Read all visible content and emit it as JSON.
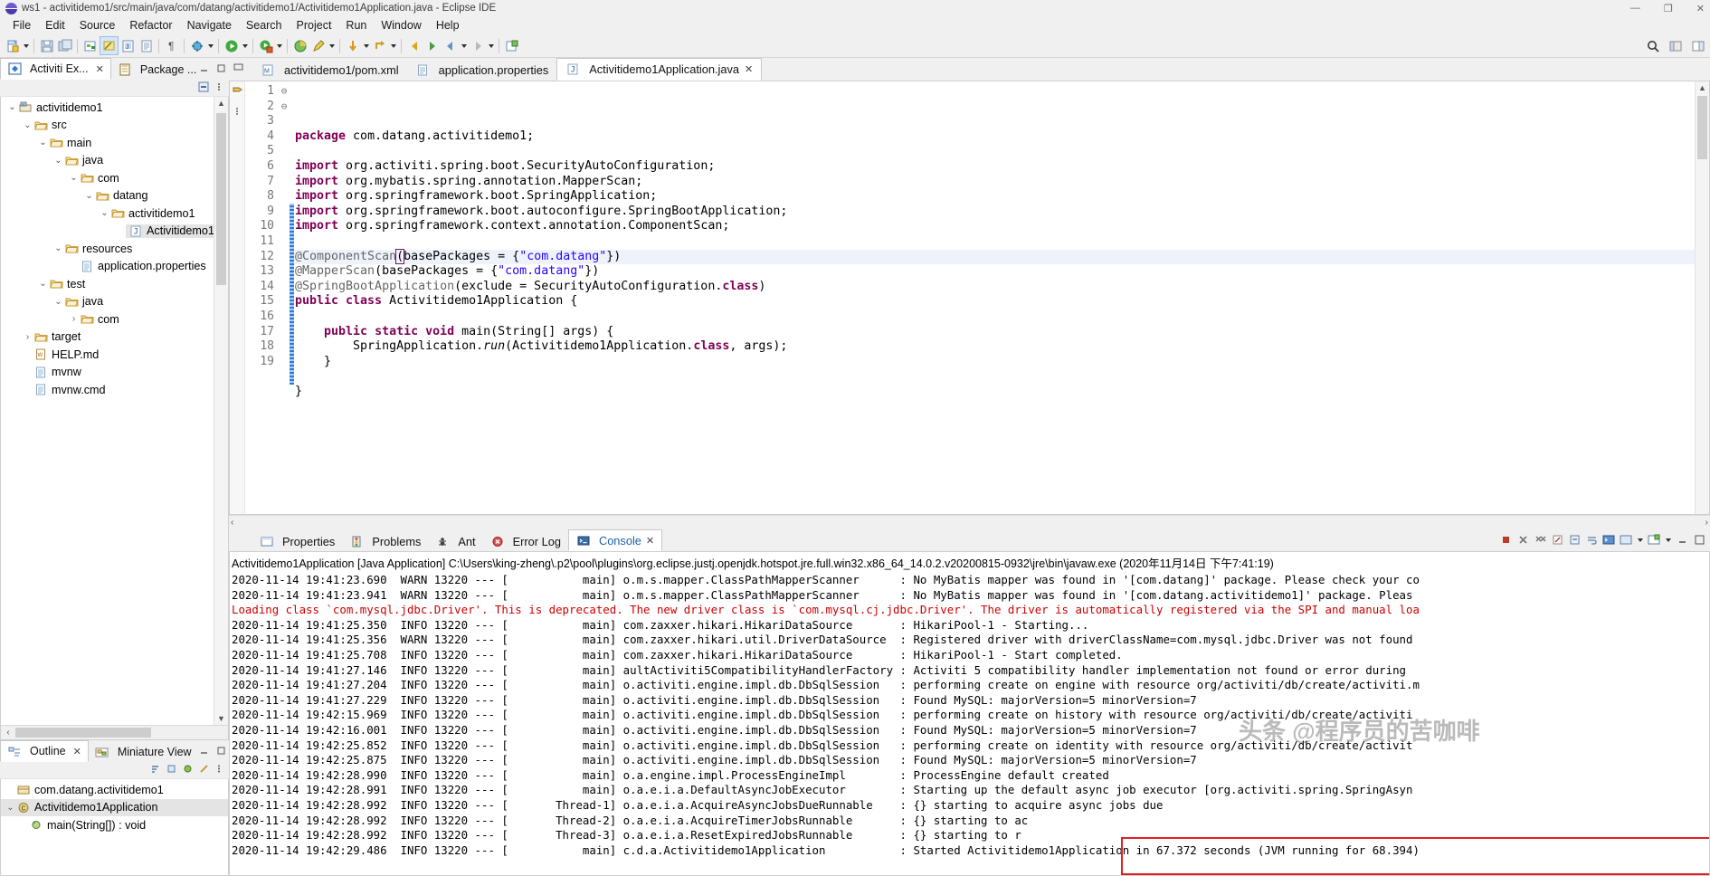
{
  "window": {
    "title": "ws1 - activitidemo1/src/main/java/com/datang/activitidemo1/Activitidemo1Application.java - Eclipse IDE",
    "minimize": "—",
    "maximize": "❐",
    "close": "✕"
  },
  "menu": [
    "File",
    "Edit",
    "Source",
    "Refactor",
    "Navigate",
    "Search",
    "Project",
    "Run",
    "Window",
    "Help"
  ],
  "left_panel": {
    "tabs": [
      {
        "label": "Activiti Ex...",
        "icon": "activiti-diamond-icon",
        "active": true,
        "close": "✕"
      },
      {
        "label": "Package ...",
        "icon": "package-explorer-icon",
        "active": false,
        "close": ""
      }
    ],
    "tree": [
      {
        "indent": 0,
        "twisty": "v",
        "icon": "project-icon",
        "label": "activitidemo1",
        "selected": false
      },
      {
        "indent": 1,
        "twisty": "v",
        "icon": "folder-icon",
        "label": "src",
        "selected": false
      },
      {
        "indent": 2,
        "twisty": "v",
        "icon": "folder-icon",
        "label": "main",
        "selected": false
      },
      {
        "indent": 3,
        "twisty": "v",
        "icon": "folder-icon",
        "label": "java",
        "selected": false
      },
      {
        "indent": 4,
        "twisty": "v",
        "icon": "folder-icon",
        "label": "com",
        "selected": false
      },
      {
        "indent": 5,
        "twisty": "v",
        "icon": "folder-icon",
        "label": "datang",
        "selected": false
      },
      {
        "indent": 6,
        "twisty": "v",
        "icon": "folder-icon",
        "label": "activitidemo1",
        "selected": false
      },
      {
        "indent": 7,
        "twisty": "",
        "icon": "java-file-icon",
        "label": "Activitidemo1",
        "selected": true
      },
      {
        "indent": 3,
        "twisty": "v",
        "icon": "folder-icon",
        "label": "resources",
        "selected": false
      },
      {
        "indent": 4,
        "twisty": "",
        "icon": "properties-file-icon",
        "label": "application.properties",
        "selected": false
      },
      {
        "indent": 2,
        "twisty": "v",
        "icon": "folder-icon",
        "label": "test",
        "selected": false
      },
      {
        "indent": 3,
        "twisty": "v",
        "icon": "folder-icon",
        "label": "java",
        "selected": false
      },
      {
        "indent": 4,
        "twisty": ">",
        "icon": "folder-icon",
        "label": "com",
        "selected": false
      },
      {
        "indent": 1,
        "twisty": ">",
        "icon": "folder-icon",
        "label": "target",
        "selected": false
      },
      {
        "indent": 1,
        "twisty": "",
        "icon": "md-file-icon",
        "label": "HELP.md",
        "selected": false
      },
      {
        "indent": 1,
        "twisty": "",
        "icon": "text-file-icon",
        "label": "mvnw",
        "selected": false
      },
      {
        "indent": 1,
        "twisty": "",
        "icon": "text-file-icon",
        "label": "mvnw.cmd",
        "selected": false
      }
    ]
  },
  "outline_panel": {
    "tabs": [
      {
        "label": "Outline",
        "icon": "outline-icon",
        "active": true,
        "close": "✕"
      },
      {
        "label": "Miniature View",
        "icon": "miniature-view-icon",
        "active": false,
        "close": ""
      }
    ],
    "items": [
      {
        "indent": 0,
        "twisty": "",
        "icon": "package-icon",
        "label": "com.datang.activitidemo1",
        "selected": false
      },
      {
        "indent": 0,
        "twisty": "v",
        "icon": "class-icon",
        "label": "Activitidemo1Application",
        "selected": true
      },
      {
        "indent": 1,
        "twisty": "",
        "icon": "method-icon",
        "label": "main(String[]) : void",
        "selected": false
      }
    ]
  },
  "editor": {
    "tabs": [
      {
        "label": "activitidemo1/pom.xml",
        "icon": "maven-file-icon",
        "active": false,
        "close": ""
      },
      {
        "label": "application.properties",
        "icon": "properties-file-icon",
        "active": false,
        "close": ""
      },
      {
        "label": "Activitidemo1Application.java",
        "icon": "java-file-icon",
        "active": true,
        "close": "✕"
      }
    ],
    "lines": [
      {
        "n": 1,
        "fold": "",
        "hl": false,
        "html": "<span class='kw'>package</span> com.datang.activitidemo1;"
      },
      {
        "n": 2,
        "fold": "",
        "hl": false,
        "html": ""
      },
      {
        "n": 3,
        "fold": "⊖",
        "hl": false,
        "html": "<span class='kw'>import</span> org.activiti.spring.boot.SecurityAutoConfiguration;"
      },
      {
        "n": 4,
        "fold": "",
        "hl": false,
        "html": "<span class='kw'>import</span> org.mybatis.spring.annotation.MapperScan;"
      },
      {
        "n": 5,
        "fold": "",
        "hl": false,
        "html": "<span class='kw'>import</span> org.springframework.boot.SpringApplication;"
      },
      {
        "n": 6,
        "fold": "",
        "hl": false,
        "html": "<span class='kw'>import</span> org.springframework.boot.autoconfigure.SpringBootApplication;"
      },
      {
        "n": 7,
        "fold": "",
        "hl": false,
        "html": "<span class='kw'>import</span> org.springframework.context.annotation.ComponentScan;"
      },
      {
        "n": 8,
        "fold": "",
        "hl": false,
        "html": ""
      },
      {
        "n": 9,
        "fold": "",
        "hl": true,
        "html": "<span class='ann'>@ComponentScan</span><span class='bracket'>(</span>basePackages = {<span class='str'>\"com.datang\"</span>})"
      },
      {
        "n": 10,
        "fold": "",
        "hl": false,
        "html": "<span class='ann'>@MapperScan</span>(basePackages = {<span class='str'>\"com.datang\"</span>})"
      },
      {
        "n": 11,
        "fold": "",
        "hl": false,
        "html": "<span class='ann'>@SpringBootApplication</span>(exclude = SecurityAutoConfiguration.<span class='kw'>class</span>)"
      },
      {
        "n": 12,
        "fold": "",
        "hl": false,
        "html": "<span class='kw'>public class</span> Activitidemo1Application {"
      },
      {
        "n": 13,
        "fold": "",
        "hl": false,
        "html": ""
      },
      {
        "n": 14,
        "fold": "⊖",
        "hl": false,
        "html": "    <span class='kw'>public static void</span> main(String[] args) {"
      },
      {
        "n": 15,
        "fold": "",
        "hl": false,
        "html": "        SpringApplication.<span class='ital'>run</span>(Activitidemo1Application.<span class='kw'>class</span>, args);"
      },
      {
        "n": 16,
        "fold": "",
        "hl": false,
        "html": "    }"
      },
      {
        "n": 17,
        "fold": "",
        "hl": false,
        "html": ""
      },
      {
        "n": 18,
        "fold": "",
        "hl": false,
        "html": "}"
      },
      {
        "n": 19,
        "fold": "",
        "hl": false,
        "html": ""
      }
    ]
  },
  "console_panel": {
    "tabs": [
      {
        "label": "Properties",
        "icon": "properties-icon",
        "active": false,
        "close": ""
      },
      {
        "label": "Problems",
        "icon": "problems-icon",
        "active": false,
        "close": ""
      },
      {
        "label": "Ant",
        "icon": "ant-icon",
        "active": false,
        "close": ""
      },
      {
        "label": "Error Log",
        "icon": "error-log-icon",
        "active": false,
        "close": ""
      },
      {
        "label": "Console",
        "icon": "console-icon",
        "active": true,
        "close": "✕"
      }
    ],
    "header": "Activitidemo1Application [Java Application] C:\\Users\\king-zheng\\.p2\\pool\\plugins\\org.eclipse.justj.openjdk.hotspot.jre.full.win32.x86_64_14.0.2.v20200815-0932\\jre\\bin\\javaw.exe  (2020年11月14日 下午7:41:19)",
    "lines": [
      {
        "error": false,
        "text": "2020-11-14 19:41:23.690  WARN 13220 --- [           main] o.m.s.mapper.ClassPathMapperScanner      : No MyBatis mapper was found in '[com.datang]' package. Please check your co"
      },
      {
        "error": false,
        "text": "2020-11-14 19:41:23.941  WARN 13220 --- [           main] o.m.s.mapper.ClassPathMapperScanner      : No MyBatis mapper was found in '[com.datang.activitidemo1]' package. Pleas"
      },
      {
        "error": true,
        "text": "Loading class `com.mysql.jdbc.Driver'. This is deprecated. The new driver class is `com.mysql.cj.jdbc.Driver'. The driver is automatically registered via the SPI and manual loa"
      },
      {
        "error": false,
        "text": "2020-11-14 19:41:25.350  INFO 13220 --- [           main] com.zaxxer.hikari.HikariDataSource       : HikariPool-1 - Starting..."
      },
      {
        "error": false,
        "text": "2020-11-14 19:41:25.356  WARN 13220 --- [           main] com.zaxxer.hikari.util.DriverDataSource  : Registered driver with driverClassName=com.mysql.jdbc.Driver was not found"
      },
      {
        "error": false,
        "text": "2020-11-14 19:41:25.708  INFO 13220 --- [           main] com.zaxxer.hikari.HikariDataSource       : HikariPool-1 - Start completed."
      },
      {
        "error": false,
        "text": "2020-11-14 19:41:27.146  INFO 13220 --- [           main] aultActiviti5CompatibilityHandlerFactory : Activiti 5 compatibility handler implementation not found or error during"
      },
      {
        "error": false,
        "text": "2020-11-14 19:41:27.204  INFO 13220 --- [           main] o.activiti.engine.impl.db.DbSqlSession   : performing create on engine with resource org/activiti/db/create/activiti.m"
      },
      {
        "error": false,
        "text": "2020-11-14 19:41:27.229  INFO 13220 --- [           main] o.activiti.engine.impl.db.DbSqlSession   : Found MySQL: majorVersion=5 minorVersion=7"
      },
      {
        "error": false,
        "text": "2020-11-14 19:42:15.969  INFO 13220 --- [           main] o.activiti.engine.impl.db.DbSqlSession   : performing create on history with resource org/activiti/db/create/activiti"
      },
      {
        "error": false,
        "text": "2020-11-14 19:42:16.001  INFO 13220 --- [           main] o.activiti.engine.impl.db.DbSqlSession   : Found MySQL: majorVersion=5 minorVersion=7"
      },
      {
        "error": false,
        "text": "2020-11-14 19:42:25.852  INFO 13220 --- [           main] o.activiti.engine.impl.db.DbSqlSession   : performing create on identity with resource org/activiti/db/create/activit"
      },
      {
        "error": false,
        "text": "2020-11-14 19:42:25.875  INFO 13220 --- [           main] o.activiti.engine.impl.db.DbSqlSession   : Found MySQL: majorVersion=5 minorVersion=7"
      },
      {
        "error": false,
        "text": "2020-11-14 19:42:28.990  INFO 13220 --- [           main] o.a.engine.impl.ProcessEngineImpl        : ProcessEngine default created"
      },
      {
        "error": false,
        "text": "2020-11-14 19:42:28.991  INFO 13220 --- [           main] o.a.e.i.a.DefaultAsyncJobExecutor        : Starting up the default async job executor [org.activiti.spring.SpringAsyn"
      },
      {
        "error": false,
        "text": "2020-11-14 19:42:28.992  INFO 13220 --- [       Thread-1] o.a.e.i.a.AcquireAsyncJobsDueRunnable    : {} starting to acquire async jobs due"
      },
      {
        "error": false,
        "text": "2020-11-14 19:42:28.992  INFO 13220 --- [       Thread-2] o.a.e.i.a.AcquireTimerJobsRunnable       : {} starting to ac"
      },
      {
        "error": false,
        "text": "2020-11-14 19:42:28.992  INFO 13220 --- [       Thread-3] o.a.e.i.a.ResetExpiredJobsRunnable       : {} starting to r"
      },
      {
        "error": false,
        "text": "2020-11-14 19:42:29.486  INFO 13220 --- [           main] c.d.a.Activitidemo1Application           : Started Activitidemo1Application in 67.372 seconds (JVM running for 68.394)"
      }
    ],
    "watermark": "头条 @程序员的苦咖啡"
  }
}
